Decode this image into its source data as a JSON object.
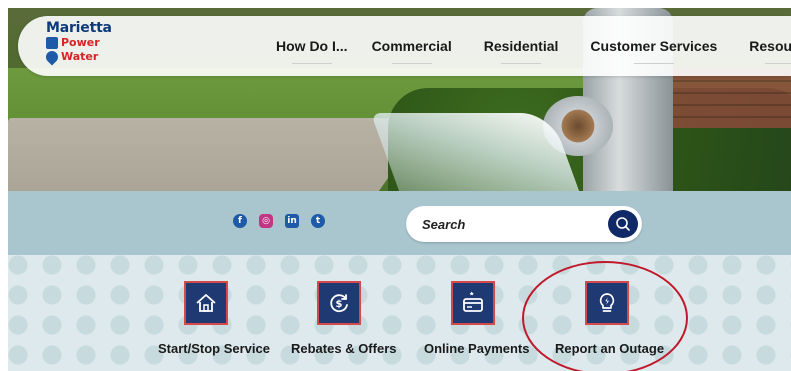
{
  "logo": {
    "line1": "Marietta",
    "line2": "Power",
    "line3": "Water"
  },
  "nav": {
    "items": [
      {
        "label": "How Do I..."
      },
      {
        "label": "Commercial"
      },
      {
        "label": "Residential"
      },
      {
        "label": "Customer Services"
      },
      {
        "label": "Resources"
      }
    ]
  },
  "social": {
    "icons": [
      "facebook-icon",
      "instagram-icon",
      "linkedin-icon",
      "twitter-icon"
    ],
    "glyphs": [
      "f",
      "◎",
      "in",
      "t"
    ]
  },
  "search": {
    "placeholder": "Search",
    "button_icon": "search-icon"
  },
  "quick_links": [
    {
      "label": "Start/Stop Service",
      "icon": "house-icon"
    },
    {
      "label": "Rebates & Offers",
      "icon": "dollar-cycle-icon"
    },
    {
      "label": "Online Payments",
      "icon": "card-payment-icon"
    },
    {
      "label": "Report an Outage",
      "icon": "lightbulb-bolt-icon"
    }
  ],
  "colors": {
    "brand_navy": "#1f3a73",
    "accent_red": "#d44a4a",
    "band": "#a9c6cf",
    "highlight_circle": "#c0192b"
  }
}
